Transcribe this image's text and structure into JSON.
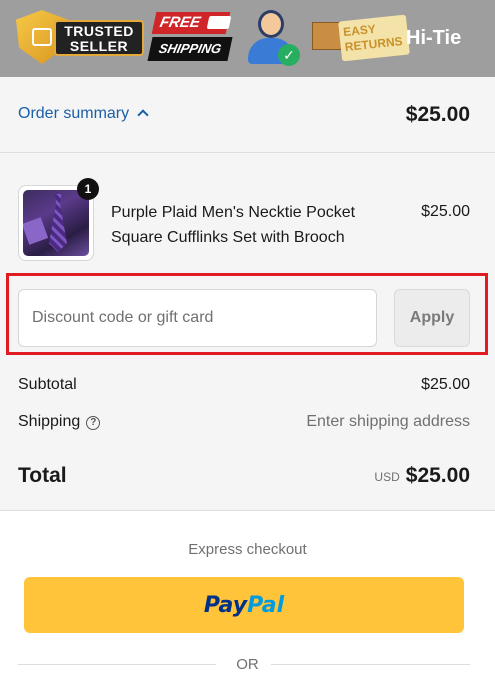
{
  "header": {
    "badges": {
      "trusted_seller": "TRUSTED SELLER",
      "free_top": "FREE",
      "free_bottom": "SHIPPING",
      "easy_returns": "EASY RETURNS"
    },
    "brand": "Hi-Tie"
  },
  "summary_bar": {
    "toggle_label": "Order summary",
    "total": "$25.00"
  },
  "cart": {
    "items": [
      {
        "name": "Purple Plaid Men's Necktie Pocket Square Cufflinks Set with Brooch",
        "quantity": "1",
        "price": "$25.00"
      }
    ]
  },
  "discount": {
    "placeholder": "Discount code or gift card",
    "apply_label": "Apply",
    "highlight_color": "#e01b22"
  },
  "totals": {
    "subtotal_label": "Subtotal",
    "subtotal_value": "$25.00",
    "shipping_label": "Shipping",
    "shipping_value": "Enter shipping address",
    "total_label": "Total",
    "currency": "USD",
    "total_value": "$25.00"
  },
  "express": {
    "title": "Express checkout",
    "paypal_pay": "Pay",
    "paypal_pal": "Pal",
    "paypal_color": "#ffc439",
    "or_label": "OR"
  },
  "icons": [
    "shopping-bag-icon",
    "truck-icon",
    "support-agent-icon",
    "checkmark-icon",
    "box-icon",
    "chevron-up-icon",
    "help-icon"
  ]
}
